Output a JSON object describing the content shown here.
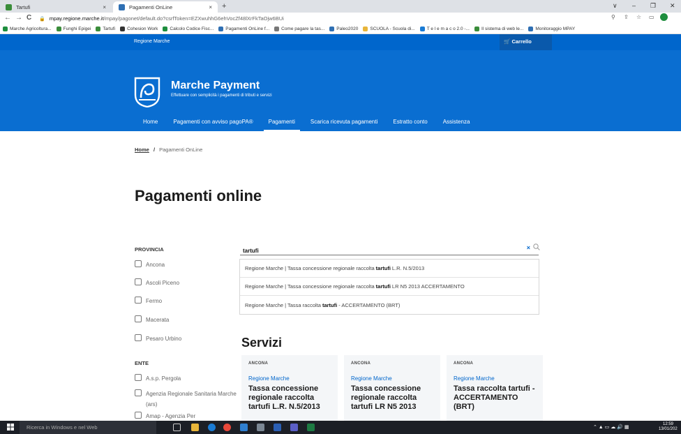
{
  "browser": {
    "tabs": [
      {
        "title": "Tartufi",
        "close": "×",
        "active": false
      },
      {
        "title": "Pagamenti OnLine",
        "close": "×",
        "active": true
      }
    ],
    "new_tab": "+",
    "window_controls": [
      "∨",
      "–",
      "❐",
      "✕"
    ],
    "nav": {
      "back": "←",
      "forward": "→",
      "reload": "C"
    },
    "url_host": "mpay.regione.marche.it",
    "url_path": "/mpay/pagonet/default.do?csrfToken=EZXwuhhG6ehVocZf48lXrFkTaOjw6BUi",
    "bookmarks": [
      "Marche Agricoltura...",
      "Funghi Epigei",
      "Tartufi",
      "Cohesion Work",
      "Calcolo Codice Fisc...",
      "Pagamenti OnLine f...",
      "Come pagare la tas...",
      "Paleo2020",
      "SCUOLA - Scuola di...",
      "T e l e m a c o 2.0 -...",
      "Il sistema di web le...",
      "Monitoraggio MPAY"
    ]
  },
  "site": {
    "top_region": "Regione Marche",
    "cart_label": "Carrello",
    "brand_title": "Marche Payment",
    "brand_subtitle": "Effettuare con semplicità i pagamenti di tributi e servizi",
    "nav": [
      "Home",
      "Pagamenti con avviso pagoPA®",
      "Pagamenti",
      "Scarica ricevuta pagamenti",
      "Estratto conto",
      "Assistenza"
    ],
    "breadcrumb_home": "Home",
    "breadcrumb_sep": "/",
    "breadcrumb_current": "Pagamenti OnLine",
    "page_title": "Pagamenti online"
  },
  "filters": {
    "provincia_label": "PROVINCIA",
    "provincia": [
      "Ancona",
      "Ascoli Piceno",
      "Fermo",
      "Macerata",
      "Pesaro Urbino"
    ],
    "ente_label": "ENTE",
    "ente": [
      "A.s.p. Pergola",
      "Agenzia Regionale Sanitaria Marche (ars)",
      "Amap - Agenzia Per"
    ]
  },
  "search": {
    "value": "tartufi",
    "clear": "×",
    "suggestions": [
      {
        "pre": "Regione Marche | Tassa concessione regionale raccolta",
        "hl": "tartufi",
        "post": "L.R. N.5/2013"
      },
      {
        "pre": "Regione Marche | Tassa concessione regionale raccolta",
        "hl": "tartufi",
        "post": "LR N5 2013 ACCERTAMENTO"
      },
      {
        "pre": "Regione Marche | Tassa raccolta",
        "hl": "tartufi",
        "post": "- ACCERTAMENTO (BRT)"
      }
    ]
  },
  "servizi": {
    "title": "Servizi",
    "cards": [
      {
        "prov": "ANCONA",
        "ente": "Regione Marche",
        "name": "Tassa concessione regionale raccolta tartufi L.R. N.5/2013"
      },
      {
        "prov": "ANCONA",
        "ente": "Regione Marche",
        "name": "Tassa concessione regionale raccolta tartufi LR N5 2013"
      },
      {
        "prov": "ANCONA",
        "ente": "Regione Marche",
        "name": "Tassa raccolta tartufi - ACCERTAMENTO (BRT)"
      }
    ]
  },
  "taskbar": {
    "search_placeholder": "Ricerca in Windows e nel Web",
    "time": "12:59",
    "date": "13/01/202"
  },
  "colors": {
    "primary": "#0066cc",
    "header": "#0a6ed1"
  }
}
